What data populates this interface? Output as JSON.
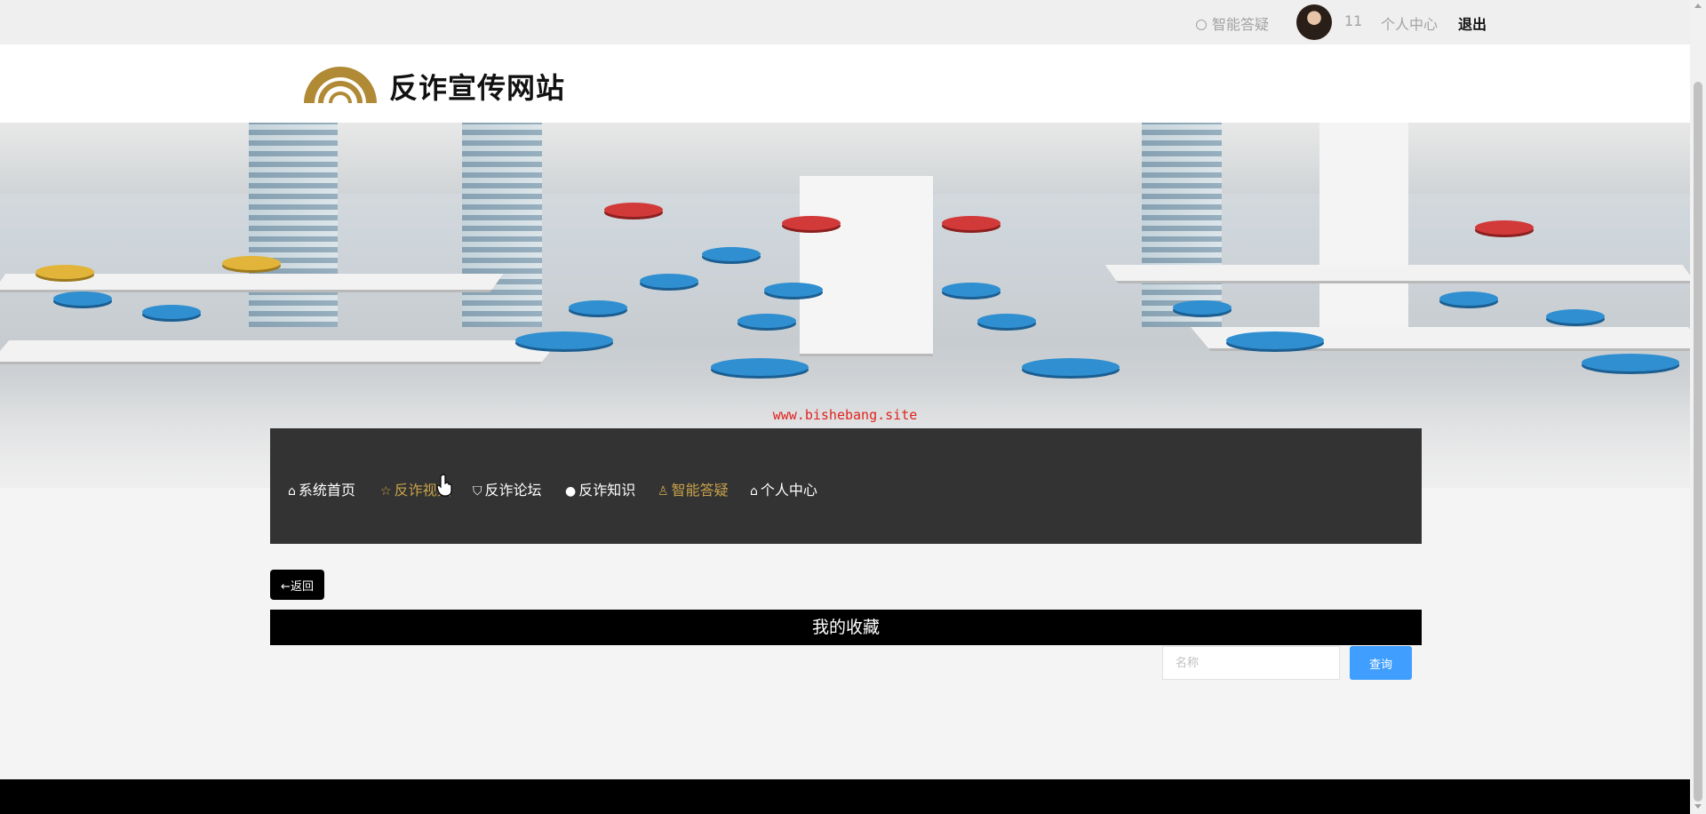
{
  "topbar": {
    "ai_link": "智能答疑",
    "username": "11",
    "personal_center": "个人中心",
    "logout": "退出"
  },
  "header": {
    "site_title": "反诈宣传网站",
    "logo_color": "#b08a35"
  },
  "banner": {
    "watermark": "www.bishebang.site"
  },
  "nav": {
    "items": [
      {
        "label": "系统首页",
        "icon": "home-icon",
        "active": false
      },
      {
        "label": "反诈视频",
        "icon": "star-icon",
        "active": true
      },
      {
        "label": "反诈论坛",
        "icon": "bag-icon",
        "active": false
      },
      {
        "label": "反诈知识",
        "icon": "info-icon",
        "active": false
      },
      {
        "label": "智能答疑",
        "icon": "user-icon",
        "active": true
      },
      {
        "label": "个人中心",
        "icon": "home-icon",
        "active": false
      }
    ],
    "active_color": "#c9a24a"
  },
  "content": {
    "back_label": "←返回",
    "section_title": "我的收藏",
    "search_placeholder": "名称",
    "search_value": "",
    "search_button": "查询",
    "search_button_color": "#409eff"
  }
}
